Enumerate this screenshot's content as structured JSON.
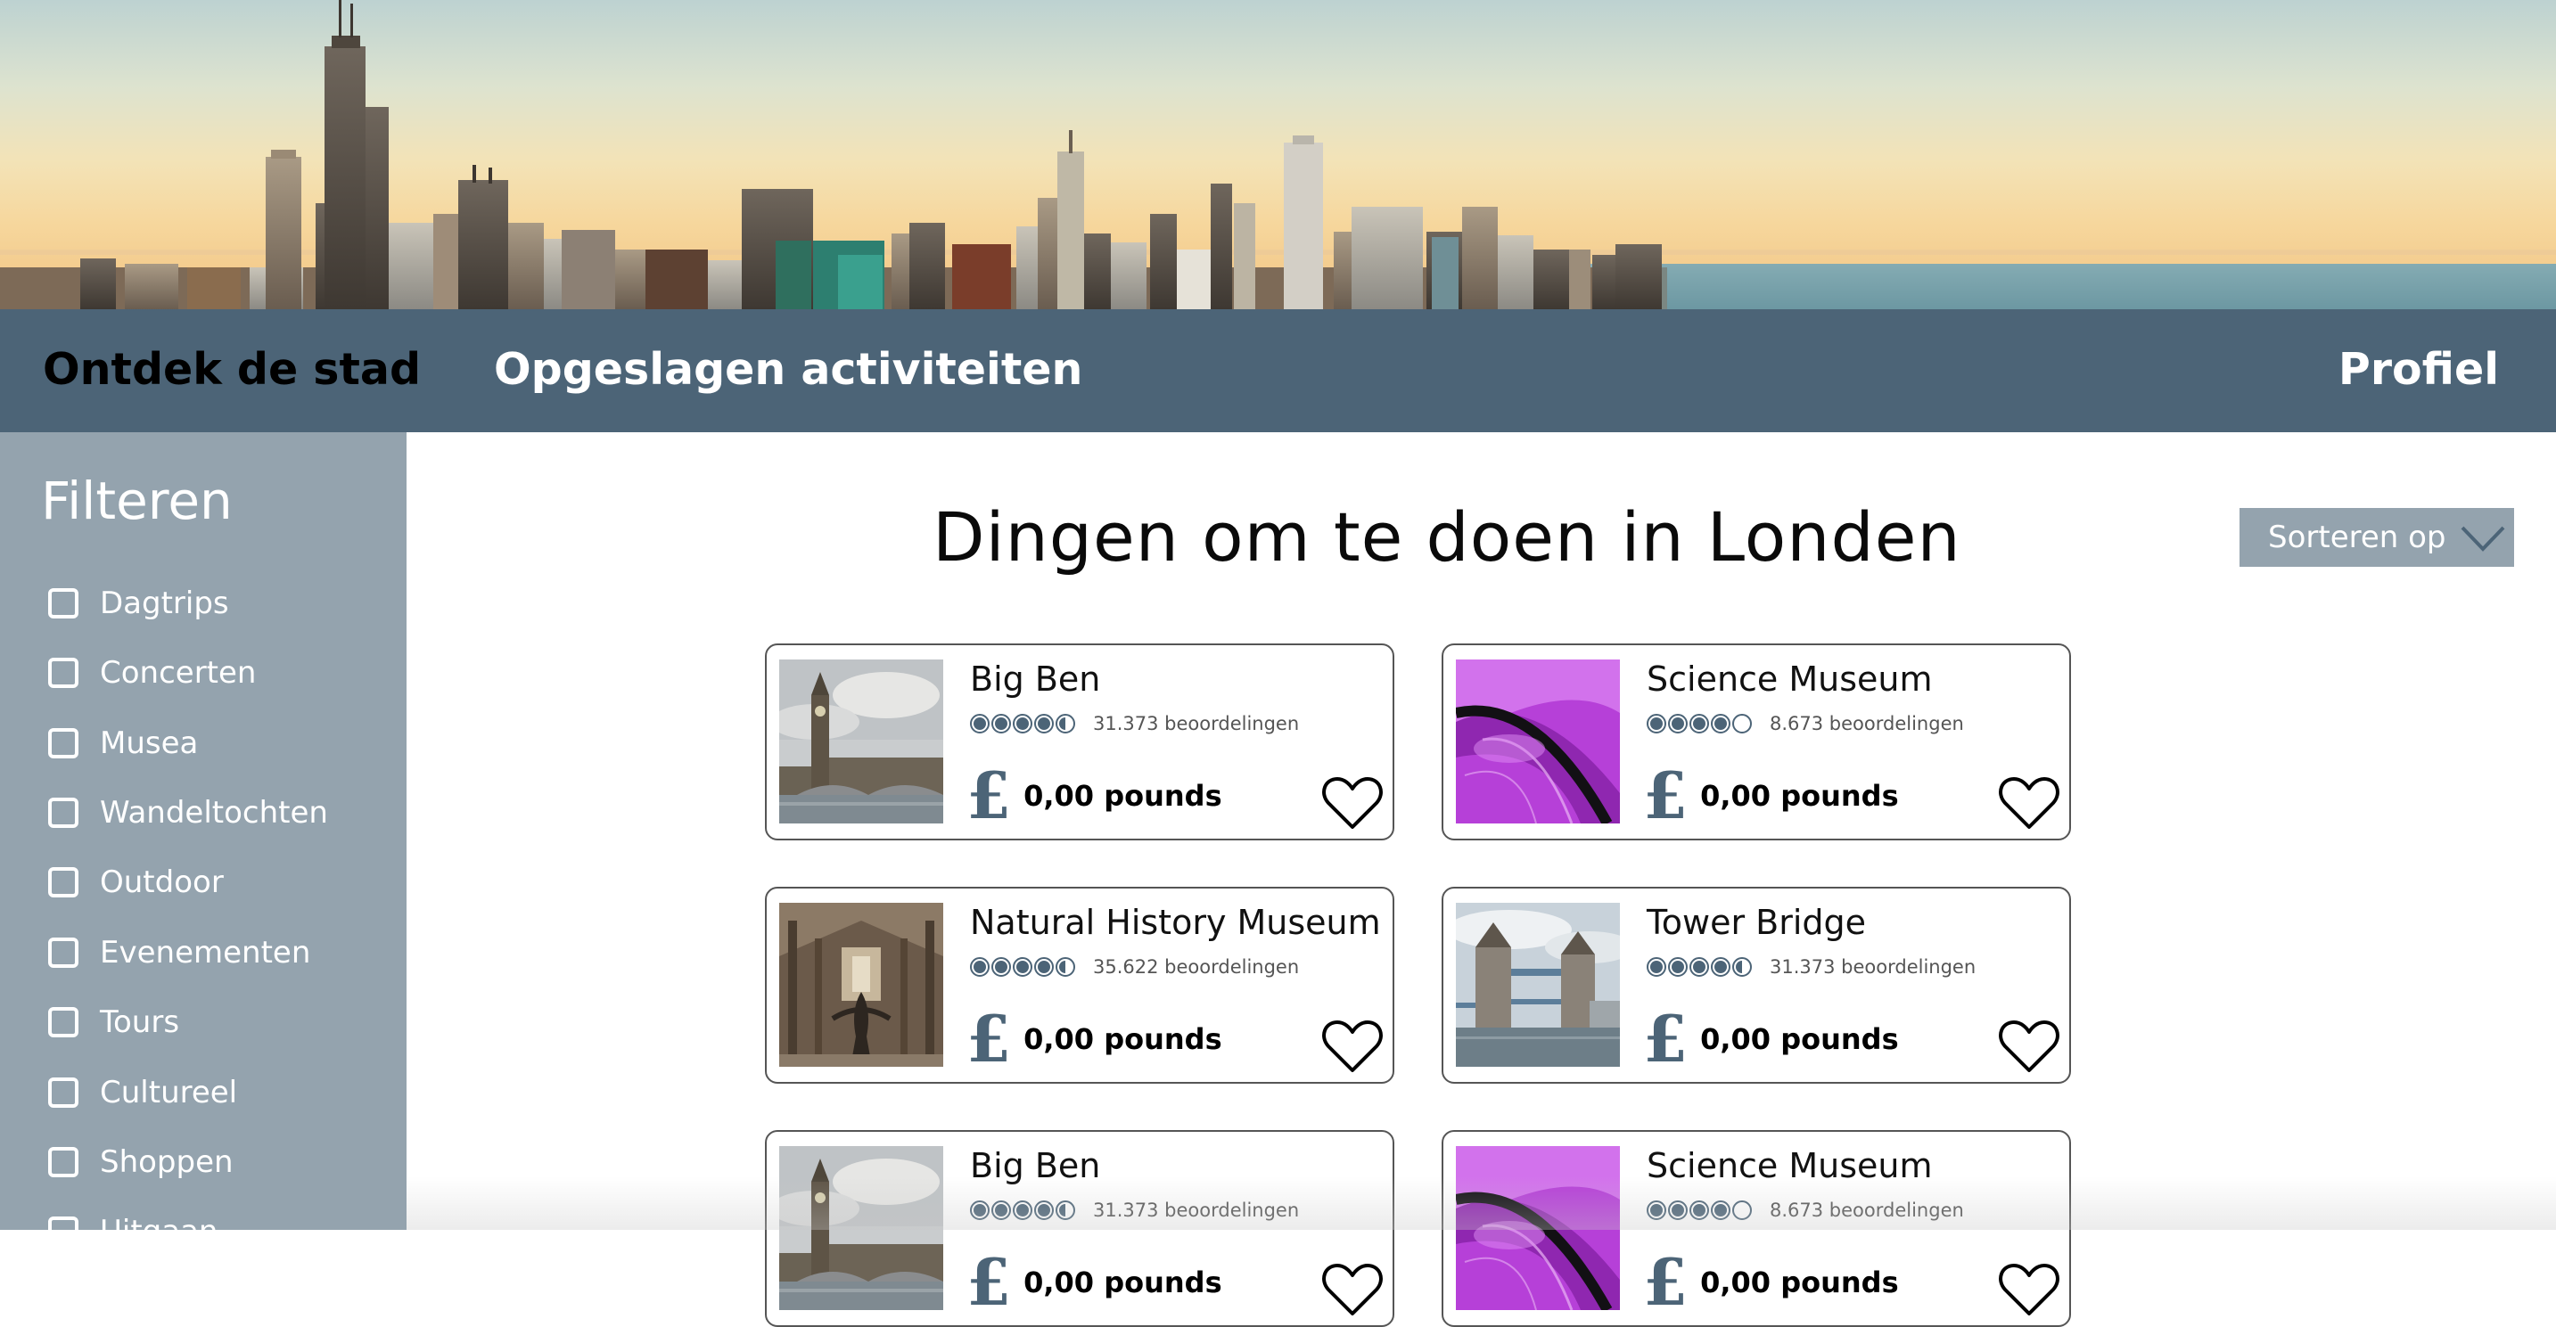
{
  "nav": {
    "items": [
      {
        "label": "Ontdek de stad",
        "active": true
      },
      {
        "label": "Opgeslagen activiteiten",
        "active": false
      },
      {
        "label": "Profiel",
        "active": false
      }
    ]
  },
  "sidebar": {
    "title": "Filteren",
    "filters": [
      {
        "label": "Dagtrips",
        "checked": false
      },
      {
        "label": "Concerten",
        "checked": false
      },
      {
        "label": "Musea",
        "checked": false
      },
      {
        "label": "Wandeltochten",
        "checked": false
      },
      {
        "label": "Outdoor",
        "checked": false
      },
      {
        "label": "Evenementen",
        "checked": false
      },
      {
        "label": "Tours",
        "checked": false
      },
      {
        "label": "Cultureel",
        "checked": false
      },
      {
        "label": "Shoppen",
        "checked": false
      },
      {
        "label": "Uitgaan",
        "checked": false
      }
    ]
  },
  "main": {
    "title": "Dingen om te doen in Londen",
    "sort_label": "Sorteren op",
    "cards": [
      {
        "title": "Big Ben",
        "rating": 4.5,
        "reviews": "31.373 beoordelingen",
        "price": "0,00 pounds",
        "thumb": "clock-tower"
      },
      {
        "title": "Science Museum",
        "rating": 4.0,
        "reviews": "8.673 beoordelingen",
        "price": "0,00 pounds",
        "thumb": "purple-abstract"
      },
      {
        "title": "Natural History Museum",
        "rating": 4.5,
        "reviews": "35.622 beoordelingen",
        "price": "0,00 pounds",
        "thumb": "museum-hall"
      },
      {
        "title": "Tower Bridge",
        "rating": 4.5,
        "reviews": "31.373 beoordelingen",
        "price": "0,00 pounds",
        "thumb": "bridge"
      },
      {
        "title": "Big Ben",
        "rating": 4.5,
        "reviews": "31.373 beoordelingen",
        "price": "0,00 pounds",
        "thumb": "clock-tower"
      },
      {
        "title": "Science Museum",
        "rating": 4.0,
        "reviews": "8.673 beoordelingen",
        "price": "0,00 pounds",
        "thumb": "purple-abstract"
      }
    ]
  },
  "colors": {
    "nav_bg": "#4c6477",
    "sidebar_bg": "#94a3ae",
    "accent": "#4c6477",
    "rating_fill": "#4c6477"
  },
  "icons": {
    "currency": "£",
    "save": "heart-icon",
    "sort": "chevron-down-icon",
    "rating": "circle-rating-icon"
  }
}
